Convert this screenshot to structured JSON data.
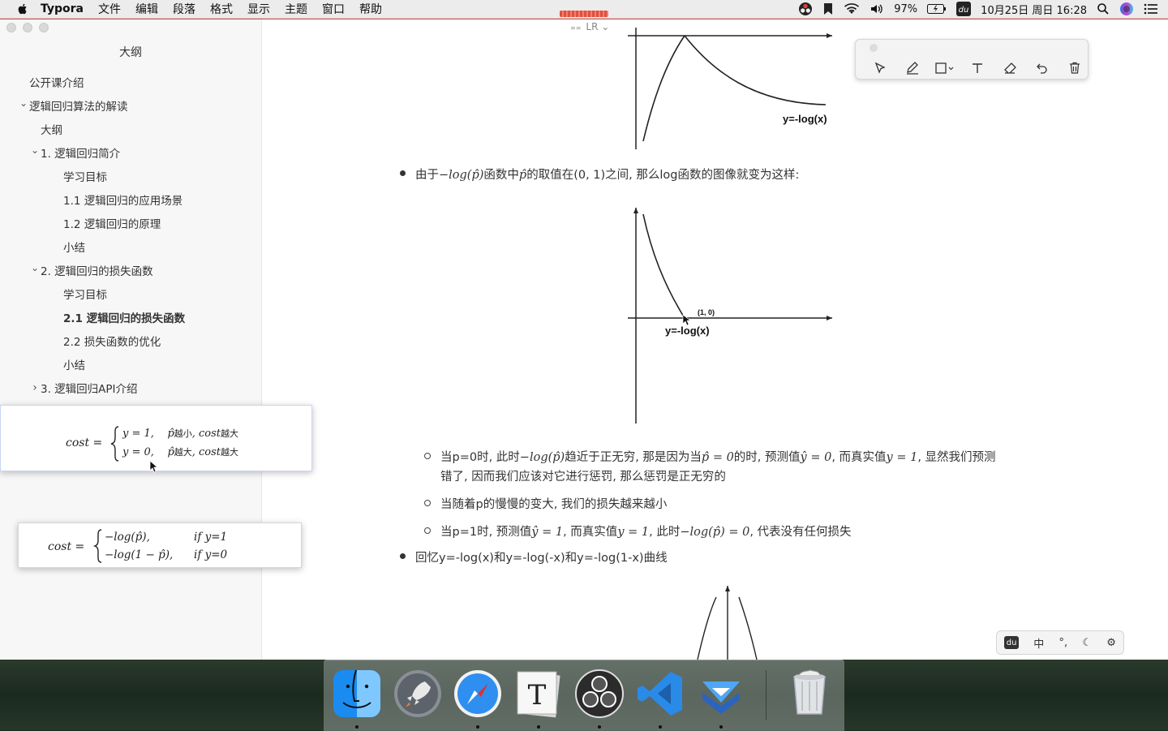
{
  "menubar": {
    "app_name": "Typora",
    "menus": [
      "文件",
      "编辑",
      "段落",
      "格式",
      "显示",
      "主题",
      "窗口",
      "帮助"
    ],
    "battery": "97%",
    "datetime": "10月25日 周日 16:28"
  },
  "sidebar": {
    "title": "大纲",
    "items": [
      {
        "label": "公开课介绍",
        "level": 0,
        "caret": ""
      },
      {
        "label": "逻辑回归算法的解读",
        "level": 0,
        "caret": "open"
      },
      {
        "label": "大纲",
        "level": 1,
        "caret": ""
      },
      {
        "label": "1. 逻辑回归简介",
        "level": 1,
        "caret": "open"
      },
      {
        "label": "学习目标",
        "level": 2,
        "caret": ""
      },
      {
        "label": "1.1 逻辑回归的应用场景",
        "level": 2,
        "caret": ""
      },
      {
        "label": "1.2 逻辑回归的原理",
        "level": 2,
        "caret": ""
      },
      {
        "label": "小结",
        "level": 2,
        "caret": ""
      },
      {
        "label": "2. 逻辑回归的损失函数",
        "level": 1,
        "caret": "open"
      },
      {
        "label": "学习目标",
        "level": 2,
        "caret": ""
      },
      {
        "label": "2.1 逻辑回归的损失函数",
        "level": 2,
        "caret": "",
        "active": true
      },
      {
        "label": "2.2 损失函数的优化",
        "level": 2,
        "caret": ""
      },
      {
        "label": "小结",
        "level": 2,
        "caret": ""
      },
      {
        "label": "3. 逻辑回归API介绍",
        "level": 1,
        "caret": "closed"
      }
    ]
  },
  "editor": {
    "mode_label": "LR",
    "graph1_label": "y=-log(x)",
    "bullet1": {
      "pre": "由于",
      "m1": "−log(p̂)",
      "mid1": "函数中",
      "m2": "p̂",
      "mid2": "的取值在(0, 1)之间, 那么log函数的图像就变为这样:"
    },
    "graph2_point": "(1, 0)",
    "graph2_label": "y=-log(x)",
    "sub1": {
      "t1": "当p=0时, 此时",
      "m1": "−log(p̂)",
      "t2": "趋近于正无穷, 那是因为当",
      "m2": "p̂ = 0",
      "t3": "的时, 预测值",
      "m3": "ŷ = 0",
      "t4": ", 而真实值",
      "m4": "y = 1",
      "t5": ", 显然我们预测",
      "line2": "错了, 因而我们应该对它进行惩罚, 那么惩罚是正无穷的"
    },
    "sub2": "当随着p的慢慢的变大, 我们的损失越来越小",
    "sub3": {
      "t1": "当p=1时, 预测值",
      "m1": "ŷ = 1",
      "t2": ", 而真实值",
      "m2": "y = 1",
      "t3": ", 此时",
      "m3": "−log(p̂) = 0",
      "t4": ", 代表没有任何损失"
    },
    "bullet2": "回忆y=-log(x)和y=-log(-x)和y=-log(1-x)曲线"
  },
  "popup1": {
    "lhs": "cost =",
    "row1_cond": "y = 1,",
    "row1_p": "p̂",
    "row1_a": "越小",
    "row1_b": ", cost",
    "row1_c": "越大",
    "row2_cond": "y = 0,",
    "row2_p": "p̂",
    "row2_a": "越大",
    "row2_b": ", cost",
    "row2_c": "越大"
  },
  "popup2": {
    "lhs": "cost =",
    "row1_expr": "−log(p̂),",
    "row1_if": "if  y=1",
    "row2_expr": "−log(1 − p̂),",
    "row2_if": "if  y=0"
  },
  "ime": {
    "chinese": "中",
    "punct": "°,"
  },
  "dock": {
    "apps": [
      "finder-icon",
      "launchpad-icon",
      "safari-icon",
      "typora-icon",
      "obs-icon",
      "vscode-icon",
      "app-icon",
      "trash-icon"
    ]
  },
  "colors": {
    "accent_red": "#e8453a",
    "popup_border": "#c9d5f5"
  }
}
